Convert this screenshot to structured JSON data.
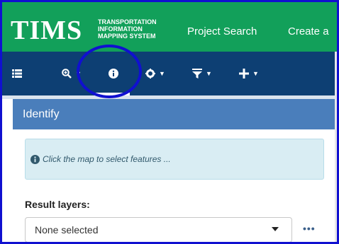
{
  "header": {
    "logo_main": "TIMS",
    "logo_sub_lines": [
      "TRANSPORTATION",
      "INFORMATION",
      "MAPPING SYSTEM"
    ],
    "nav": {
      "project_search": "Project Search",
      "create": "Create a"
    }
  },
  "toolbar": {
    "items": [
      {
        "icon": "list-icon",
        "caret": false
      },
      {
        "icon": "zoom-in-icon",
        "caret": true
      },
      {
        "icon": "info-icon",
        "caret": false,
        "active": true
      },
      {
        "icon": "gear-icon",
        "caret": true
      },
      {
        "icon": "filter-icon",
        "caret": true
      },
      {
        "icon": "plus-icon",
        "caret": true
      }
    ]
  },
  "panel": {
    "title": "Identify",
    "hint": "Click the map to select features ...",
    "result_layers_label": "Result layers:",
    "result_layers_value": "None selected",
    "more_label": "•••"
  },
  "colors": {
    "header_bg": "#12a05a",
    "toolbar_bg": "#0d3f73",
    "panel_title_bg": "#4a7ebb",
    "alert_bg": "#d9edf3",
    "annotation": "#1010d0"
  }
}
